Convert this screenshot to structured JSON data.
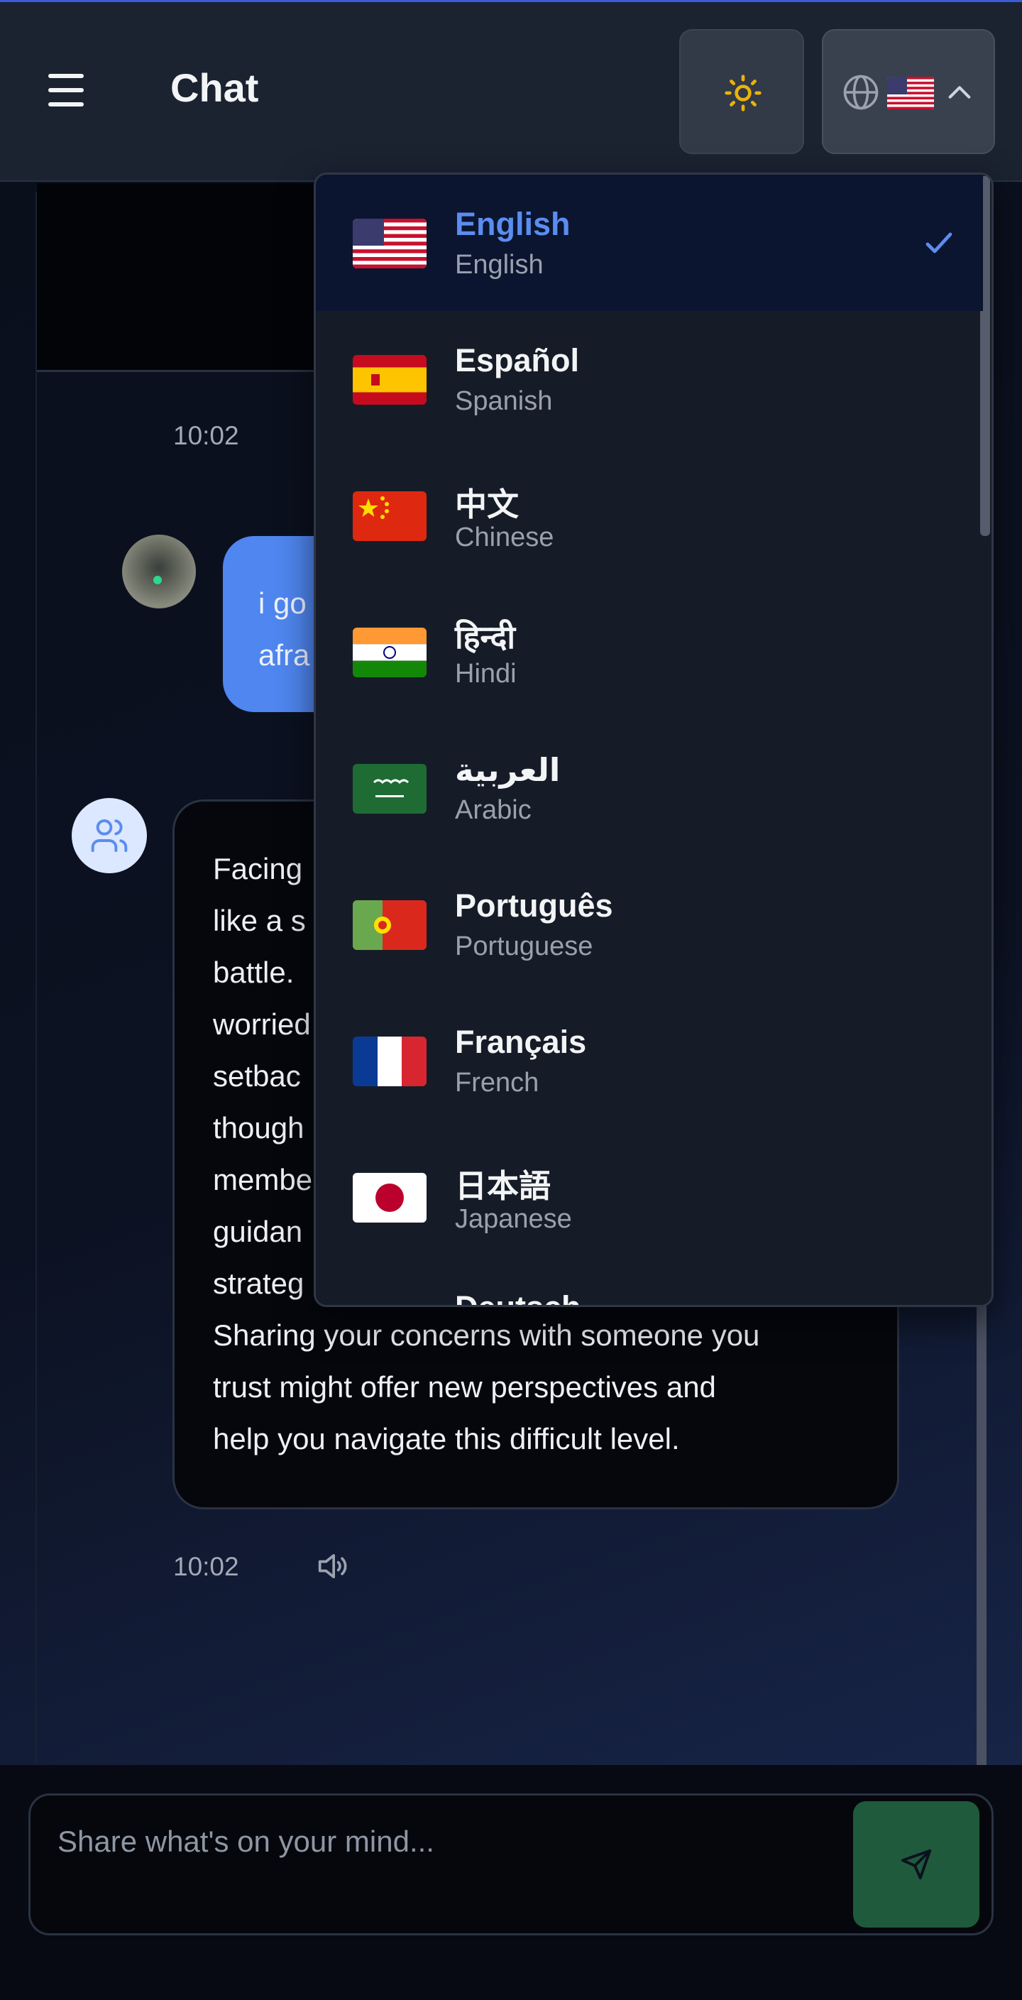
{
  "header": {
    "title": "Chat",
    "theme_icon": "sun-icon",
    "language_icon": "globe-icon",
    "current_flag": "us-flag",
    "dropdown_icon": "chevron-up-icon",
    "menu_icon": "hamburger-icon"
  },
  "messages": [
    {
      "role": "user",
      "time": "10:02",
      "lines": [
        "i go",
        "afra"
      ]
    },
    {
      "role": "assistant",
      "time": "10:02",
      "lines": [
        "Facing",
        "like a s",
        "battle.",
        "worried",
        "setbac",
        "though",
        "membe",
        "guidan",
        "strateg",
        "Sharing your concerns with someone you",
        "trust might offer new perspectives and",
        "help you navigate this difficult level."
      ]
    }
  ],
  "language_menu": {
    "selected": "English",
    "items": [
      {
        "native": "English",
        "english": "English",
        "flag": "us-flag"
      },
      {
        "native": "Español",
        "english": "Spanish",
        "flag": "es-flag"
      },
      {
        "native": "中文",
        "english": "Chinese",
        "flag": "cn-flag"
      },
      {
        "native": "हिन्दी",
        "english": "Hindi",
        "flag": "in-flag"
      },
      {
        "native": "العربية",
        "english": "Arabic",
        "flag": "sa-flag"
      },
      {
        "native": "Português",
        "english": "Portuguese",
        "flag": "pt-flag"
      },
      {
        "native": "Français",
        "english": "French",
        "flag": "fr-flag"
      },
      {
        "native": "日本語",
        "english": "Japanese",
        "flag": "jp-flag"
      }
    ],
    "partial_next": "Deutsch"
  },
  "input": {
    "placeholder": "Share what's on your mind...",
    "send_icon": "send-icon"
  },
  "colors": {
    "accent": "#5b8def",
    "user_bubble": "#4f86f0",
    "send_button": "#1f5a3c",
    "sun": "#eab308"
  }
}
